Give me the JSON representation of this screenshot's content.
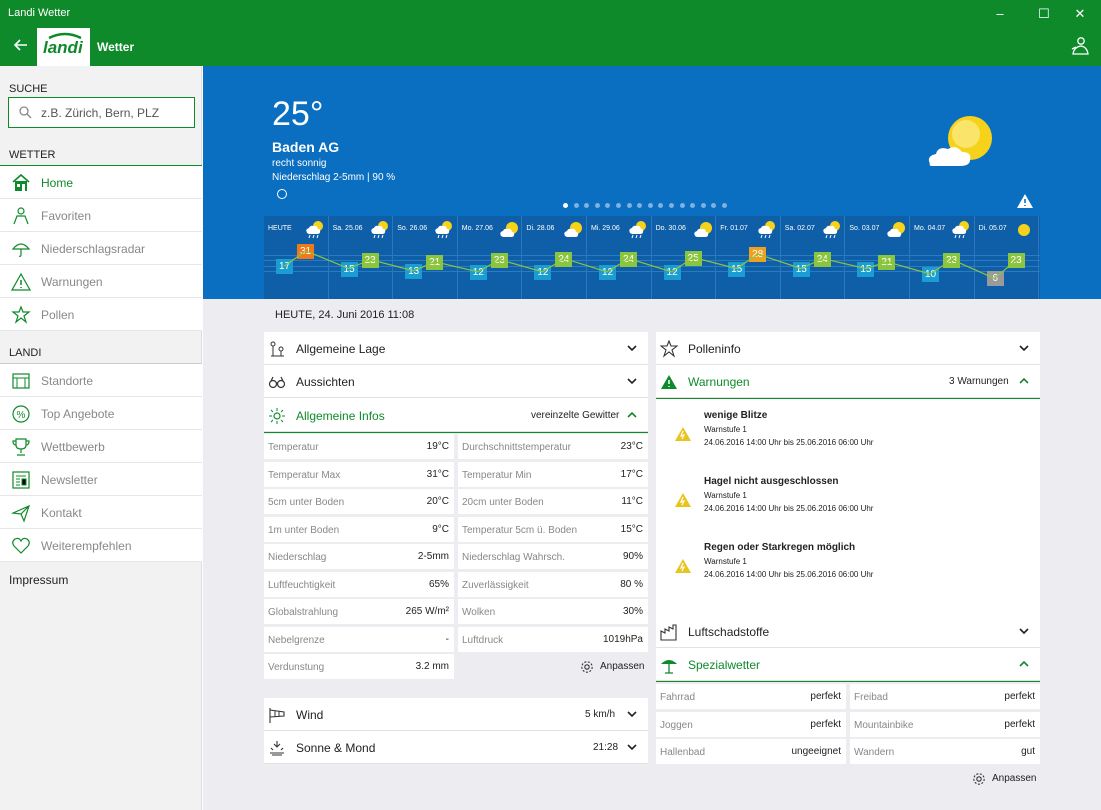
{
  "window": {
    "title": "Landi Wetter"
  },
  "appbar": {
    "logo": "landi",
    "title": "Wetter"
  },
  "sidebar": {
    "search_header": "SUCHE",
    "search_placeholder": "z.B. Zürich, Bern, PLZ",
    "weather_header": "WETTER",
    "weather_items": [
      {
        "label": "Home",
        "icon": "home-icon"
      },
      {
        "label": "Favoriten",
        "icon": "favorites-icon"
      },
      {
        "label": "Niederschlagsradar",
        "icon": "umbrella-icon"
      },
      {
        "label": "Warnungen",
        "icon": "warning-icon"
      },
      {
        "label": "Pollen",
        "icon": "pollen-icon"
      }
    ],
    "landi_header": "LANDI",
    "landi_items": [
      {
        "label": "Standorte",
        "icon": "store-icon"
      },
      {
        "label": "Top Angebote",
        "icon": "percent-icon"
      },
      {
        "label": "Wettbewerb",
        "icon": "trophy-icon"
      },
      {
        "label": "Newsletter",
        "icon": "newsletter-icon"
      },
      {
        "label": "Kontakt",
        "icon": "send-icon"
      },
      {
        "label": "Weiterempfehlen",
        "icon": "heart-icon"
      }
    ],
    "impressum": "Impressum"
  },
  "current": {
    "temperature": "25°",
    "location": "Baden AG",
    "condition": "recht sonnig",
    "precipitation": "Niederschlag 2-5mm | 90 %"
  },
  "forecast": [
    {
      "label": "HEUTE",
      "min": "17",
      "max": "31",
      "max_color": "#f07a1a",
      "icon": "cloud-rain-icon"
    },
    {
      "label": "Sa. 25.06",
      "min": "15",
      "max": "23",
      "max_color": "#8bc53f",
      "icon": "cloud-rain-icon"
    },
    {
      "label": "So. 26.06",
      "min": "13",
      "max": "21",
      "max_color": "#8bc53f",
      "icon": "cloud-rain-icon"
    },
    {
      "label": "Mo. 27.06",
      "min": "12",
      "max": "23",
      "max_color": "#8bc53f",
      "icon": "sun-cloud-icon"
    },
    {
      "label": "Di. 28.06",
      "min": "12",
      "max": "24",
      "max_color": "#8bc53f",
      "icon": "sun-cloud-icon"
    },
    {
      "label": "Mi. 29.06",
      "min": "12",
      "max": "24",
      "max_color": "#8bc53f",
      "icon": "cloud-rain-icon"
    },
    {
      "label": "Do. 30.06",
      "min": "12",
      "max": "25",
      "max_color": "#8bc53f",
      "icon": "sun-cloud-icon"
    },
    {
      "label": "Fr. 01.07",
      "min": "15",
      "max": "28",
      "max_color": "#f0a020",
      "icon": "cloud-rain-icon"
    },
    {
      "label": "Sa. 02.07",
      "min": "15",
      "max": "24",
      "max_color": "#8bc53f",
      "icon": "cloud-rain-icon"
    },
    {
      "label": "So. 03.07",
      "min": "15",
      "max": "21",
      "max_color": "#8bc53f",
      "icon": "sun-cloud-icon"
    },
    {
      "label": "Mo. 04.07",
      "min": "10",
      "max": "23",
      "max_color": "#8bc53f",
      "icon": "cloud-rain-icon"
    },
    {
      "label": "Di. 05.07",
      "min": "6",
      "max": "23",
      "max_color": "#8bc53f",
      "min_color": "#9a9a9a",
      "icon": "sun-icon"
    }
  ],
  "date_header": "HEUTE, 24. Juni 2016 11:08",
  "left_panel": {
    "allgemeine_lage": "Allgemeine Lage",
    "aussichten": "Aussichten",
    "allgemeine_infos": "Allgemeine Infos",
    "infos_summary": "vereinzelte Gewitter",
    "details": [
      {
        "label": "Temperatur",
        "value": "19°C"
      },
      {
        "label": "Durchschnittstemperatur",
        "value": "23°C"
      },
      {
        "label": "Temperatur Max",
        "value": "31°C"
      },
      {
        "label": "Temperatur Min",
        "value": "17°C"
      },
      {
        "label": "5cm unter Boden",
        "value": "20°C"
      },
      {
        "label": "20cm unter Boden",
        "value": "11°C"
      },
      {
        "label": "1m unter Boden",
        "value": "9°C"
      },
      {
        "label": "Temperatur 5cm ü. Boden",
        "value": "15°C"
      },
      {
        "label": "Niederschlag",
        "value": "2-5mm"
      },
      {
        "label": "Niederschlag Wahrsch.",
        "value": "90%"
      },
      {
        "label": "Luftfeuchtigkeit",
        "value": "65%"
      },
      {
        "label": "Zuverlässigkeit",
        "value": "80 %"
      },
      {
        "label": "Globalstrahlung",
        "value": "265 W/m²"
      },
      {
        "label": "Wolken",
        "value": "30%"
      },
      {
        "label": "Nebelgrenze",
        "value": "-"
      },
      {
        "label": "Luftdruck",
        "value": "1019hPa"
      },
      {
        "label": "Verdunstung",
        "value": "3.2 mm"
      }
    ],
    "adjust": "Anpassen",
    "wind": "Wind",
    "wind_value": "5 km/h",
    "sun_moon": "Sonne & Mond",
    "sun_moon_value": "21:28"
  },
  "right_panel": {
    "polleninfo": "Polleninfo",
    "warnungen": "Warnungen",
    "warnungen_count": "3 Warnungen",
    "warnings": [
      {
        "title": "wenige Blitze",
        "level": "Warnstufe 1",
        "date": "24.06.2016 14:00 Uhr bis 25.06.2016 06:00 Uhr"
      },
      {
        "title": "Hagel nicht ausgeschlossen",
        "level": "Warnstufe 1",
        "date": "24.06.2016 14:00 Uhr bis 25.06.2016 06:00 Uhr"
      },
      {
        "title": "Regen oder Starkregen möglich",
        "level": "Warnstufe 1",
        "date": "24.06.2016 14:00 Uhr bis 25.06.2016 06:00 Uhr"
      }
    ],
    "luftschadstoffe": "Luftschadstoffe",
    "spezialwetter": "Spezialwetter",
    "special": [
      {
        "label": "Fahrrad",
        "value": "perfekt"
      },
      {
        "label": "Freibad",
        "value": "perfekt"
      },
      {
        "label": "Joggen",
        "value": "perfekt"
      },
      {
        "label": "Mountainbike",
        "value": "perfekt"
      },
      {
        "label": "Hallenbad",
        "value": "ungeeignet"
      },
      {
        "label": "Wandern",
        "value": "gut"
      }
    ],
    "adjust": "Anpassen"
  }
}
